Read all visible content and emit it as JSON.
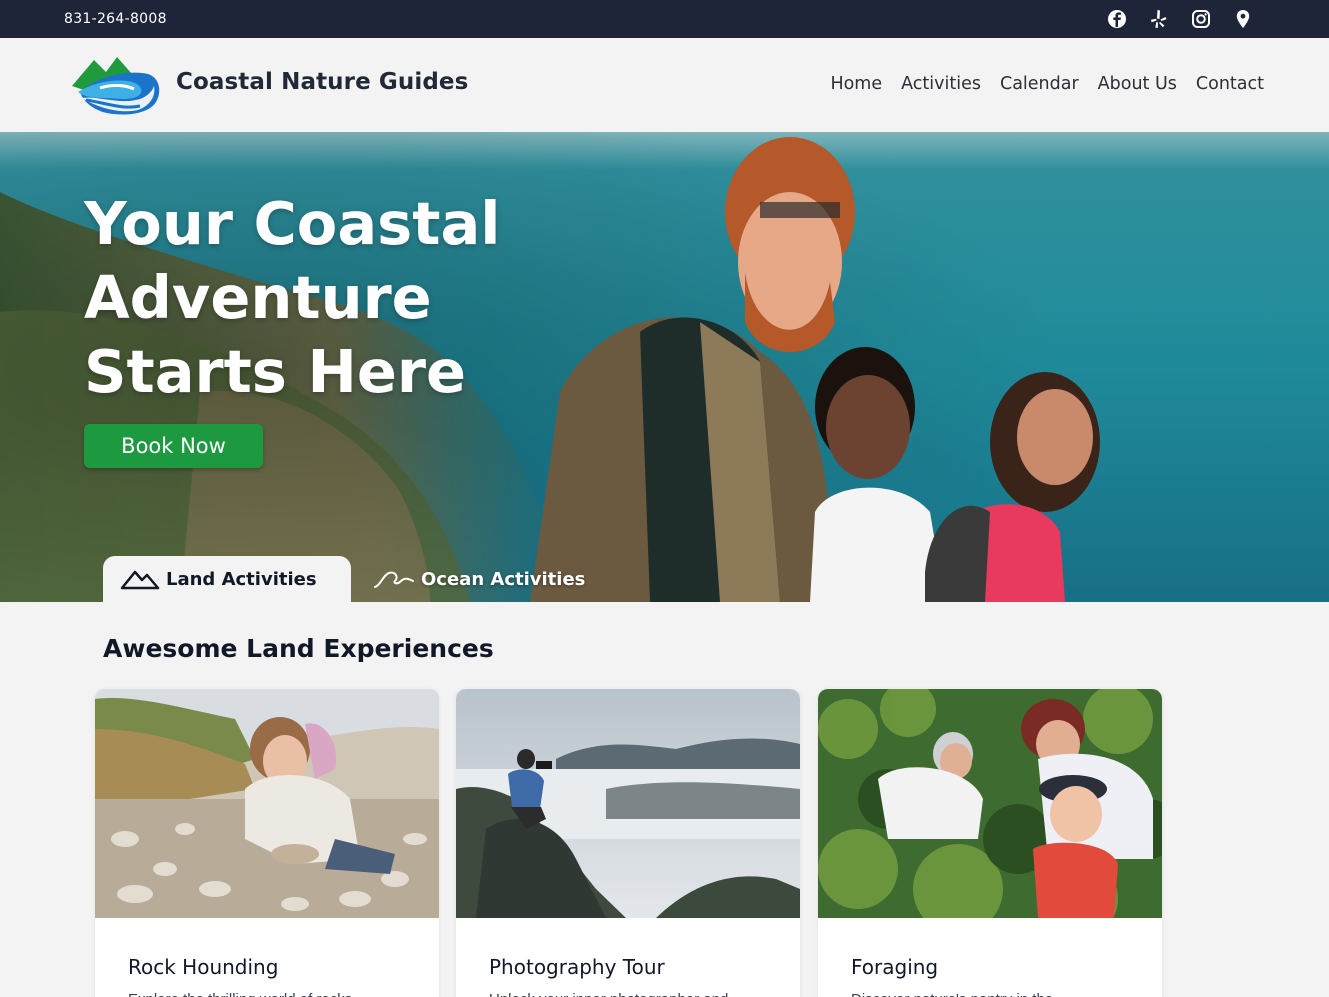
{
  "topbar": {
    "phone": "831-264-8008",
    "social_icons": [
      "facebook-icon",
      "yelp-icon",
      "instagram-icon",
      "map-pin-icon"
    ]
  },
  "header": {
    "brand": "Coastal Nature Guides",
    "logo_icon": "mountain-wave-logo",
    "nav": [
      {
        "label": "Home"
      },
      {
        "label": "Activities"
      },
      {
        "label": "Calendar"
      },
      {
        "label": "About Us"
      },
      {
        "label": "Contact"
      }
    ]
  },
  "hero": {
    "title": "Your Coastal Adventure Starts Here",
    "book_button": "Book Now",
    "tabs": [
      {
        "label": "Land Activities",
        "icon": "mountain-icon",
        "active": true
      },
      {
        "label": "Ocean Activities",
        "icon": "wave-icon",
        "active": false
      }
    ]
  },
  "section": {
    "title": "Awesome Land Experiences"
  },
  "cards": [
    {
      "title": "Rock Hounding",
      "image": "girl-collecting-rocks-on-beach"
    },
    {
      "title": "Photography Tour",
      "image": "photographer-above-fog-valley"
    },
    {
      "title": "Foraging",
      "image": "family-picking-berries"
    }
  ],
  "colors": {
    "topbar": "#1e2538",
    "accent_green": "#1d9a3f",
    "page_bg": "#f4f3f3"
  }
}
